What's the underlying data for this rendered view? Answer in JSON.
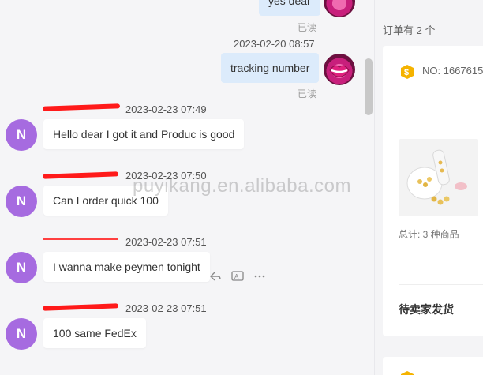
{
  "chat": {
    "messages": [
      {
        "direction": "outgoing",
        "text": "yes dear",
        "read": "已读"
      },
      {
        "direction": "outgoing",
        "timestamp": "2023-02-20 08:57",
        "text": "tracking number",
        "read": "已读"
      },
      {
        "direction": "incoming",
        "sender_initial": "N",
        "timestamp": "2023-02-23 07:49",
        "text": "Hello dear I got it and Produc is good"
      },
      {
        "direction": "incoming",
        "sender_initial": "N",
        "timestamp": "2023-02-23 07:50",
        "text": "Can I order quick 100"
      },
      {
        "direction": "incoming",
        "sender_initial": "N",
        "timestamp": "2023-02-23 07:51",
        "text": "I wanna make peymen tonight"
      },
      {
        "direction": "incoming",
        "sender_initial": "N",
        "timestamp": "2023-02-23 07:51",
        "text": "100 same FedEx"
      }
    ],
    "message_actions": [
      "reply-icon",
      "translate-icon",
      "more-icon"
    ]
  },
  "order_panel": {
    "count_label": "订单有 2 个",
    "order_no": "NO: 1667615",
    "total_label": "总计: 3 种商品",
    "status": "待卖家发货"
  },
  "watermark": "puyikang.en.alibaba.com",
  "colors": {
    "avatar": "#a66be0",
    "outgoing_bubble": "#dcebfb",
    "incoming_bubble": "#ffffff",
    "redaction": "#ff1a1a",
    "coin": "#f5b300"
  }
}
